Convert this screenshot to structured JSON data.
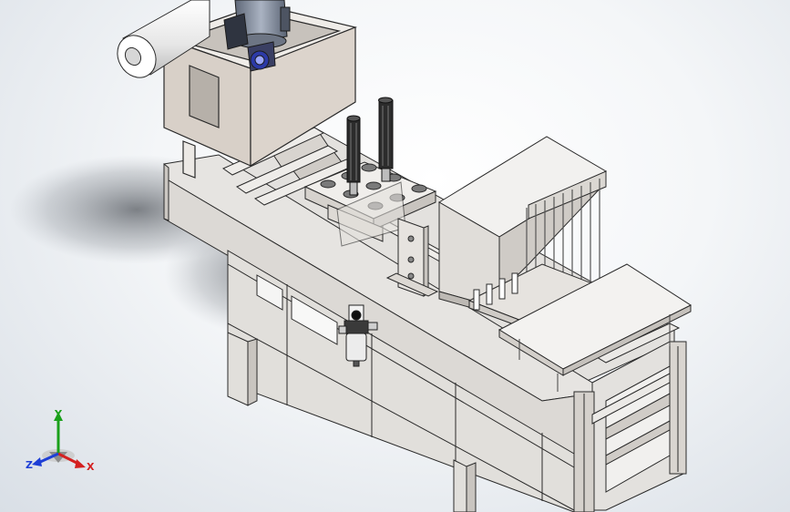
{
  "viewport": {
    "background_center": "#ffffff",
    "background_edge": "#d9dfe6"
  },
  "model": {
    "part_color": "#e3e1de",
    "shade_color": "#cfcbc6",
    "edge_color": "#2a2a2a",
    "motor_color": "#8d96a6"
  },
  "triad": {
    "axes": {
      "x_label": "X",
      "y_label": "Y",
      "z_label": "Z"
    },
    "colors": {
      "x": "#d42020",
      "y": "#1aa01a",
      "z": "#1e3fd6"
    }
  }
}
